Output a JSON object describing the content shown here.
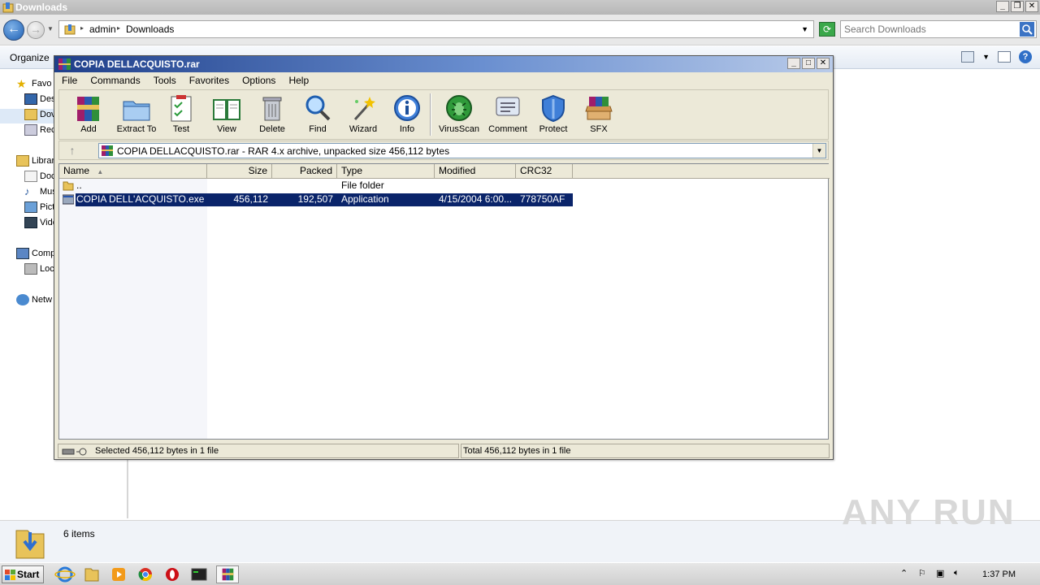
{
  "explorer": {
    "title": "Downloads",
    "breadcrumbs": [
      "admin",
      "Downloads"
    ],
    "search_placeholder": "Search Downloads",
    "toolbar": {
      "organize": "Organize"
    },
    "nav": {
      "items": [
        "Favo",
        "Des",
        "Dov",
        "Rec",
        "Librar",
        "Doc",
        "Mus",
        "Pict",
        "Vide",
        "Comp",
        "Loc",
        "Netw"
      ]
    },
    "status": {
      "count": "6 items"
    }
  },
  "winrar": {
    "title": "COPIA DELLACQUISTO.rar",
    "menu": [
      "File",
      "Commands",
      "Tools",
      "Favorites",
      "Options",
      "Help"
    ],
    "tools": [
      "Add",
      "Extract To",
      "Test",
      "View",
      "Delete",
      "Find",
      "Wizard",
      "Info",
      "VirusScan",
      "Comment",
      "Protect",
      "SFX"
    ],
    "path": "COPIA DELLACQUISTO.rar - RAR 4.x archive, unpacked size 456,112 bytes",
    "columns": [
      "Name",
      "Size",
      "Packed",
      "Type",
      "Modified",
      "CRC32"
    ],
    "rows": [
      {
        "name": "..",
        "size": "",
        "packed": "",
        "type": "File folder",
        "modified": "",
        "crc": ""
      },
      {
        "name": "COPIA DELL'ACQUISTO.exe",
        "size": "456,112",
        "packed": "192,507",
        "type": "Application",
        "modified": "4/15/2004 6:00...",
        "crc": "778750AF"
      }
    ],
    "status_left": "Selected 456,112 bytes in 1 file",
    "status_right": "Total 456,112 bytes in 1 file"
  },
  "taskbar": {
    "start": "Start",
    "clock": "1:37 PM"
  },
  "watermark": "ANY RUN"
}
